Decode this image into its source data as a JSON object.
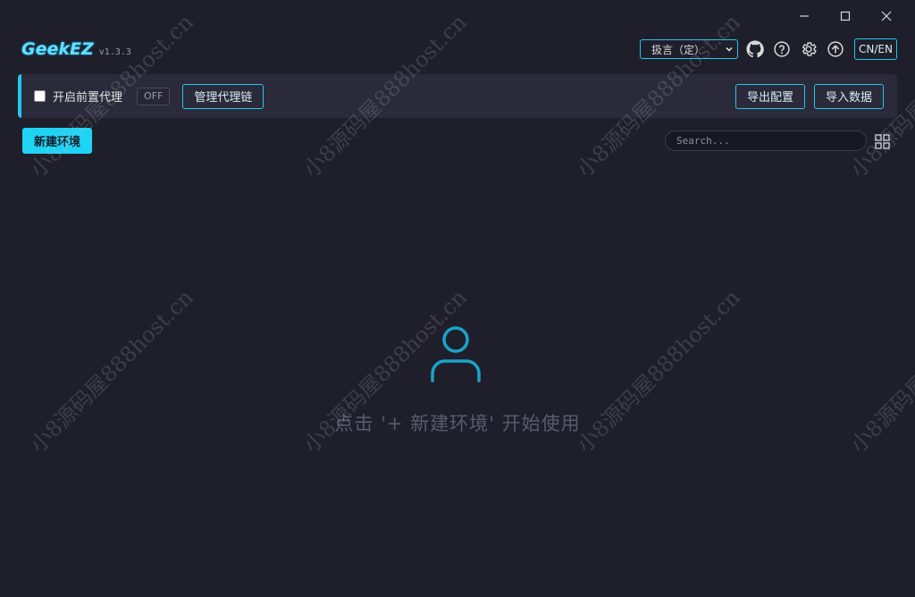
{
  "app": {
    "logo": "GeekEZ",
    "version": "v1.3.3"
  },
  "header": {
    "language_select": "扱言（定）",
    "lang_toggle": "CN/EN"
  },
  "proxy_bar": {
    "checkbox_label": "开启前置代理",
    "status": "OFF",
    "manage_chain": "管理代理链",
    "export_config": "导出配置",
    "import_data": "导入数据"
  },
  "toolbar": {
    "new_env": "新建环境",
    "search_placeholder": "Search..."
  },
  "empty_state": {
    "message": "点击 '+ 新建环境' 开始使用"
  },
  "watermark": {
    "text": "小8源码屋888host.cn"
  },
  "colors": {
    "accent": "#25c6e8",
    "primary_button": "#1fd3f5",
    "background": "#1f1f2c",
    "panel": "#2a2a3b",
    "empty_icon": "#1aa3c6"
  }
}
